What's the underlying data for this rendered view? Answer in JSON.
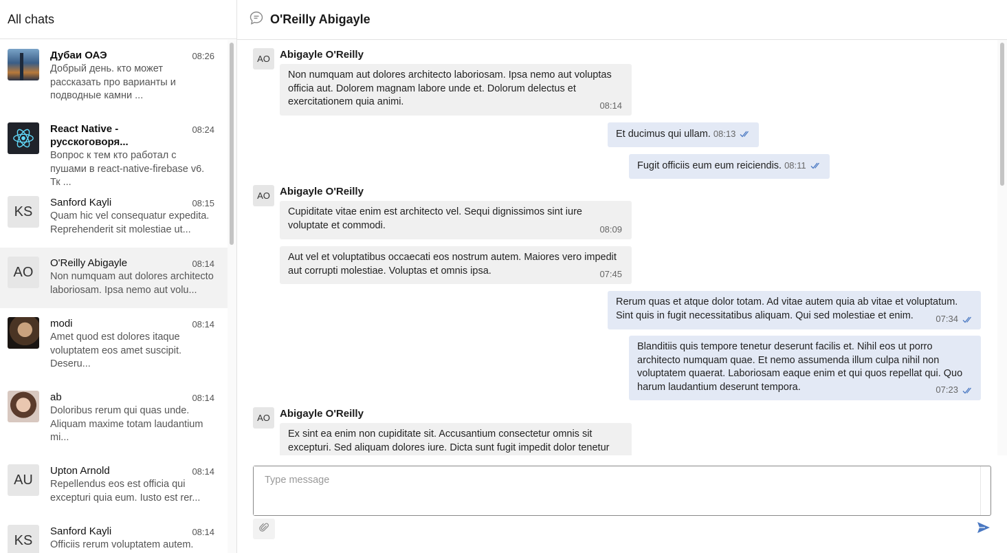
{
  "sidebar": {
    "title": "All chats",
    "chats": [
      {
        "name": "Дубаи ОАЭ",
        "time": "08:26",
        "preview": "Добрый день. кто может рассказать про варианты и подводные камни ...",
        "avatar": "image",
        "bold": true
      },
      {
        "name": "React Native - русскоговоря...",
        "time": "08:24",
        "preview": "Вопрос к тем кто работал с пушами в react-native-firebase v6. Тк ...",
        "avatar": "react-logo",
        "bold": true
      },
      {
        "name": "Sanford Kayli",
        "time": "08:15",
        "preview": "Quam hic vel consequatur expedita. Reprehenderit sit molestiae ut...",
        "avatar": "KS",
        "bold": false
      },
      {
        "name": "O'Reilly Abigayle",
        "time": "08:14",
        "preview": "Non numquam aut dolores architecto laboriosam. Ipsa nemo aut volu...",
        "avatar": "AO",
        "bold": false,
        "active": true
      },
      {
        "name": "modi",
        "time": "08:14",
        "preview": "Amet quod est dolores itaque voluptatem eos amet suscipit. Deseru...",
        "avatar": "image",
        "bold": false
      },
      {
        "name": "ab",
        "time": "08:14",
        "preview": "Doloribus rerum qui quas unde. Aliquam maxime totam laudantium mi...",
        "avatar": "image",
        "bold": false
      },
      {
        "name": "Upton Arnold",
        "time": "08:14",
        "preview": "Repellendus eos est officia qui excepturi quia eum. Iusto est rer...",
        "avatar": "AU",
        "bold": false
      },
      {
        "name": "Sanford Kayli",
        "time": "08:14",
        "preview": "Officiis rerum voluptatem autem.",
        "avatar": "KS",
        "bold": false
      }
    ]
  },
  "header": {
    "title": "O'Reilly Abigayle",
    "icon": "chat-bubble-icon"
  },
  "messages": [
    {
      "direction": "in",
      "sender": "Abigayle O'Reilly",
      "avatar": "AO",
      "text": "Non numquam aut dolores architecto laboriosam. Ipsa nemo aut voluptas officia aut. Dolorem magnam labore unde et. Dolorum delectus et exercitationem quia animi.",
      "time": "08:14"
    },
    {
      "direction": "out",
      "text": "Et ducimus qui ullam.",
      "time": "08:13",
      "read": true
    },
    {
      "direction": "out",
      "text": "Fugit officiis eum eum reiciendis.",
      "time": "08:11",
      "read": true
    },
    {
      "direction": "in",
      "sender": "Abigayle O'Reilly",
      "avatar": "AO",
      "text": "Cupiditate vitae enim est architecto vel. Sequi dignissimos sint iure voluptate et commodi.",
      "time": "08:09"
    },
    {
      "direction": "in",
      "text": "Aut vel et voluptatibus occaecati eos nostrum autem. Maiores vero impedit aut corrupti molestiae. Voluptas et omnis ipsa.",
      "time": "07:45"
    },
    {
      "direction": "out",
      "text": "Rerum quas et atque dolor totam. Ad vitae autem quia ab vitae et voluptatum. Sint quis in fugit necessitatibus aliquam. Qui sed molestiae et enim.",
      "time": "07:34",
      "read": true
    },
    {
      "direction": "out",
      "text": "Blanditiis quis tempore tenetur deserunt facilis et. Nihil eos ut porro architecto numquam quae. Et nemo assumenda illum culpa nihil non voluptatem quaerat. Laboriosam eaque enim et qui quos repellat qui. Quo harum laudantium deserunt tempora.",
      "time": "07:23",
      "read": true
    },
    {
      "direction": "in",
      "sender": "Abigayle O'Reilly",
      "avatar": "AO",
      "text": "Ex sint ea enim non cupiditate sit. Accusantium consectetur omnis sit excepturi. Sed aliquam dolores iure. Dicta sunt fugit impedit dolor tenetur",
      "time": ""
    }
  ],
  "composer": {
    "placeholder": "Type message",
    "attach_icon": "paperclip-icon",
    "send_icon": "send-icon"
  },
  "colors": {
    "outgoing_bubble": "#e3e9f5",
    "incoming_bubble": "#f0f0f0",
    "accent": "#4a78c2"
  }
}
